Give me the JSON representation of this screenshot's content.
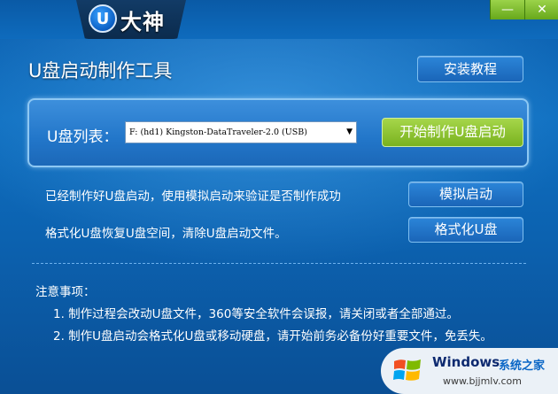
{
  "app": {
    "logo_letter": "U",
    "logo_text": "大神",
    "heading": "U盘启动制作工具"
  },
  "window_controls": {
    "minimize": "—",
    "close": "✕"
  },
  "toolbar": {
    "tutorial_label": "安装教程"
  },
  "usb": {
    "list_label": "U盘列表：",
    "selected_device": "F: (hd1) Kingston-DataTraveler-2.0 (USB)",
    "start_label": "开始制作U盘启动"
  },
  "actions": {
    "simulate_desc": "已经制作好U盘启动，使用模拟启动来验证是否制作成功",
    "simulate_label": "模拟启动",
    "format_desc": "格式化U盘恢复U盘空间，清除U盘启动文件。",
    "format_label": "格式化U盘"
  },
  "notes": {
    "title": "注意事项：",
    "items": [
      "1. 制作过程会改动U盘文件，360等安全软件会误报，请关闭或者全部通过。",
      "2. 制作U盘启动会格式化U盘或移动硬盘，请开始前务必备份好重要文件，免丢失。"
    ]
  },
  "watermark": {
    "brand": "Windows",
    "site_cn": "系统之家",
    "url": "www.bjjmlv.com"
  },
  "colors": {
    "background": "#0f6fc0",
    "accent_green": "#8cc63f",
    "button_blue": "#1f6fc4"
  },
  "icons": {
    "logo": "u-logo-icon",
    "dropdown": "chevron-down-icon",
    "windows": "windows-flag-icon"
  }
}
